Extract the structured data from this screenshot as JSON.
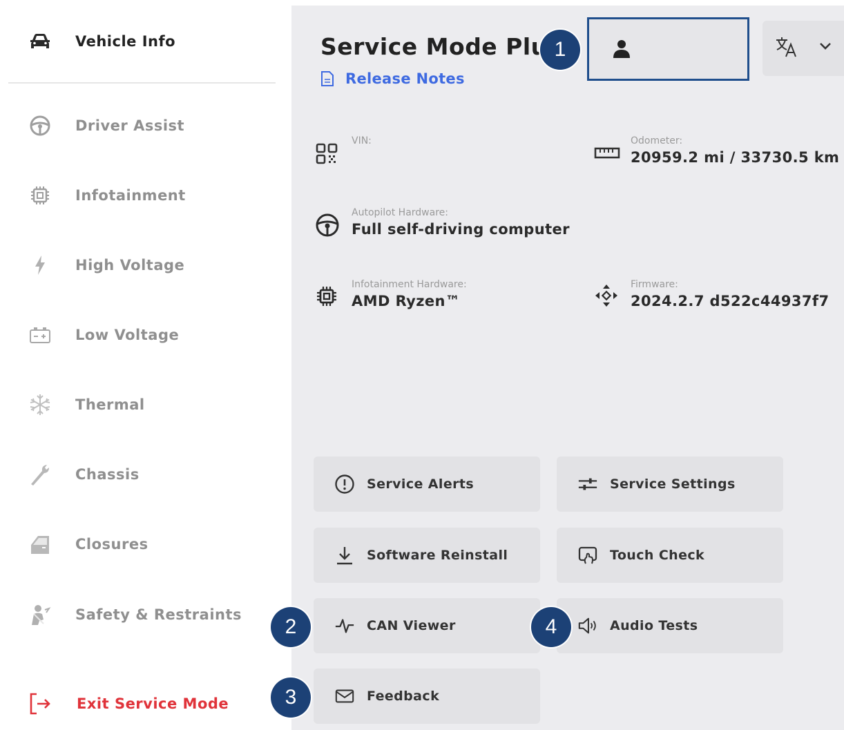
{
  "sidebar": {
    "items": [
      {
        "label": "Vehicle Info",
        "icon": "car-icon",
        "state": "active"
      },
      {
        "label": "Driver Assist",
        "icon": "steering-wheel-icon",
        "state": "inactive"
      },
      {
        "label": "Infotainment",
        "icon": "chip-icon",
        "state": "inactive"
      },
      {
        "label": "High Voltage",
        "icon": "lightning-icon",
        "state": "inactive"
      },
      {
        "label": "Low Voltage",
        "icon": "battery-icon",
        "state": "inactive"
      },
      {
        "label": "Thermal",
        "icon": "snowflake-icon",
        "state": "inactive"
      },
      {
        "label": "Chassis",
        "icon": "wrench-icon",
        "state": "inactive"
      },
      {
        "label": "Closures",
        "icon": "door-icon",
        "state": "inactive"
      },
      {
        "label": "Safety & Restraints",
        "icon": "seatbelt-icon",
        "state": "inactive"
      }
    ],
    "exit_label": "Exit Service Mode"
  },
  "header": {
    "title": "Service Mode Plus",
    "release_notes": "Release Notes"
  },
  "info": {
    "vin_label": "VIN:",
    "vin_value": "",
    "odometer_label": "Odometer:",
    "odometer_value": "20959.2 mi / 33730.5 km",
    "autopilot_label": "Autopilot Hardware:",
    "autopilot_value": "Full self-driving computer",
    "infotainment_label": "Infotainment Hardware:",
    "infotainment_value": "AMD Ryzen™",
    "firmware_label": "Firmware:",
    "firmware_value": "2024.2.7 d522c44937f7"
  },
  "buttons": {
    "service_alerts": "Service Alerts",
    "service_settings": "Service Settings",
    "software_reinstall": "Software Reinstall",
    "touch_check": "Touch Check",
    "can_viewer": "CAN Viewer",
    "audio_tests": "Audio Tests",
    "feedback": "Feedback"
  },
  "badges": {
    "b1": "1",
    "b2": "2",
    "b3": "3",
    "b4": "4"
  },
  "colors": {
    "accent_blue": "#3e6ae1",
    "exit_red": "#e0333a",
    "badge_navy": "#1c4176",
    "panel_bg": "#ececef",
    "button_bg": "#e2e2e5"
  }
}
